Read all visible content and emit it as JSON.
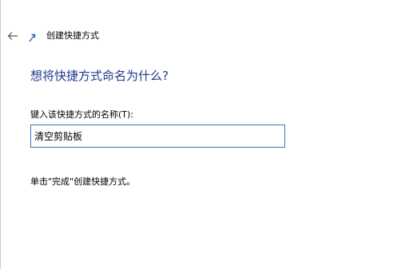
{
  "window": {
    "title": "创建快捷方式",
    "back_icon": "back-arrow-icon",
    "shortcut_icon": "shortcut-icon"
  },
  "page": {
    "heading": "想将快捷方式命名为什么?",
    "field_label": "键入该快捷方式的名称(T):",
    "name_value": "清空剪贴板",
    "hint": "单击\"完成\"创建快捷方式。"
  },
  "colors": {
    "heading": "#1f3a8c",
    "input_border": "#3f6fc4",
    "window_edge": "#b9d1ea"
  }
}
